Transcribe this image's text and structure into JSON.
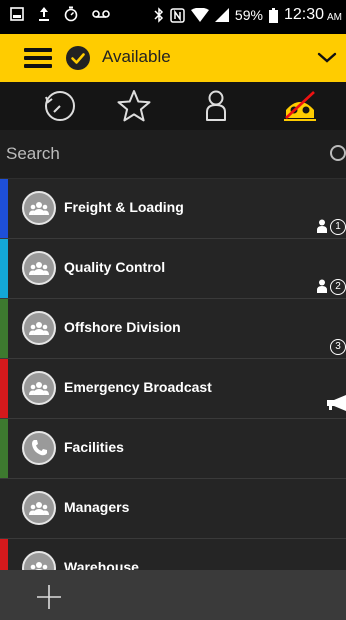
{
  "status_bar": {
    "battery_percent": "59%",
    "time": "12:30",
    "ampm": "AM"
  },
  "presence": {
    "label": "Available"
  },
  "tabs": [
    {
      "name": "recent",
      "icon": "clock-icon",
      "active": false
    },
    {
      "name": "favorites",
      "icon": "star-icon",
      "active": false
    },
    {
      "name": "contacts",
      "icon": "person-icon",
      "active": false
    },
    {
      "name": "groups",
      "icon": "channels-icon",
      "active": true
    }
  ],
  "search": {
    "placeholder": "Search"
  },
  "groups": [
    {
      "label": "Freight & Loading",
      "color": "#1e4fd8",
      "members_badge": "1"
    },
    {
      "label": "Quality Control",
      "color": "#13a7d6",
      "members_badge": "2"
    },
    {
      "label": "Offshore Division",
      "color": "#3d7a2f",
      "members_badge": "3"
    },
    {
      "label": "Emergency Broadcast",
      "color": "#d4191c",
      "broadcast": true
    },
    {
      "label": "Facilities",
      "color": "#3d7a2f",
      "icon": "phone-icon"
    },
    {
      "label": "Managers",
      "color": null
    },
    {
      "label": "Warehouse",
      "color": "#d4191c"
    }
  ],
  "colors": {
    "accent": "#ffcc00",
    "list_background": "#252525",
    "bottom_bar": "#3a3a3a"
  }
}
